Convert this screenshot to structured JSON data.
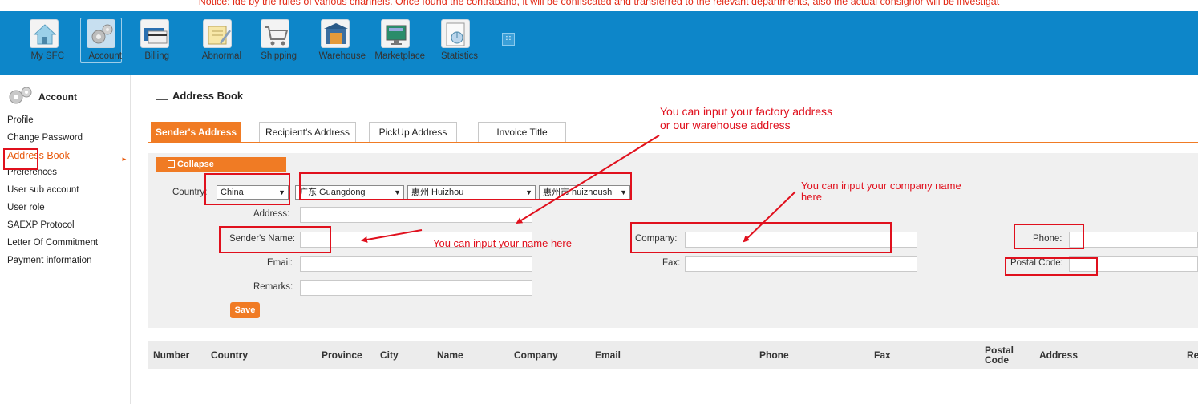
{
  "notice": {
    "text": "Notice: ide by the rules of various channels. Once found the contraband, it will be confiscated and transferred to the relevant departments, also the actual consignor will be investigat"
  },
  "topnav": {
    "items": [
      {
        "label": "My SFC",
        "icon": "home-icon"
      },
      {
        "label": "Account",
        "icon": "gears-icon"
      },
      {
        "label": "Billing",
        "icon": "credit-card-icon"
      },
      {
        "label": "Abnormal",
        "icon": "note-pencil-icon"
      },
      {
        "label": "Shipping",
        "icon": "shopping-cart-icon"
      },
      {
        "label": "Warehouse",
        "icon": "warehouse-icon"
      },
      {
        "label": "Marketplace",
        "icon": "monitor-icon"
      },
      {
        "label": "Statistics",
        "icon": "chart-icon"
      }
    ],
    "more_icon": "grid-icon",
    "active": "Account"
  },
  "sidebar": {
    "title": "Account",
    "items": [
      {
        "label": "Profile"
      },
      {
        "label": "Change Password"
      },
      {
        "label": "Address Book"
      },
      {
        "label": "Preferences"
      },
      {
        "label": "User sub account"
      },
      {
        "label": "User role"
      },
      {
        "label": "SAEXP Protocol"
      },
      {
        "label": "Letter Of Commitment"
      },
      {
        "label": "Payment information"
      }
    ],
    "active": "Address Book"
  },
  "page": {
    "title": "Address Book",
    "tabs": [
      {
        "label": "Sender's Address"
      },
      {
        "label": "Recipient's Address"
      },
      {
        "label": "PickUp Address"
      },
      {
        "label": "Invoice Title"
      }
    ],
    "collapse_label": "Collapse",
    "save_label": "Save"
  },
  "form": {
    "country_label": "Country:",
    "country_value": "China",
    "province_value": "广东 Guangdong",
    "city_value": "惠州 Huizhou",
    "district_value": "惠州市 huizhoushi",
    "address_label": "Address:",
    "address_value": "",
    "sender_name_label": "Sender's Name:",
    "sender_name_value": "",
    "company_label": "Company:",
    "company_value": "",
    "phone_label": "Phone:",
    "phone_value": "",
    "email_label": "Email:",
    "email_value": "",
    "fax_label": "Fax:",
    "fax_value": "",
    "postal_label": "Postal Code:",
    "postal_value": "",
    "remarks_label": "Remarks:",
    "remarks_value": ""
  },
  "table": {
    "columns": [
      "Number",
      "Country",
      "Province",
      "City",
      "Name",
      "Company",
      "Email",
      "Phone",
      "Fax",
      "Postal Code",
      "Address",
      "Re"
    ],
    "rows": []
  },
  "annotations": {
    "factory_note": "You can input your factory address or  our warehouse address",
    "company_note": "You can input your company name here",
    "name_note": "You can input your name here",
    "color": "#e0101d"
  },
  "colors": {
    "nav_bg": "#0d86c9",
    "accent": "#f07b24",
    "notice": "#e22b17"
  }
}
